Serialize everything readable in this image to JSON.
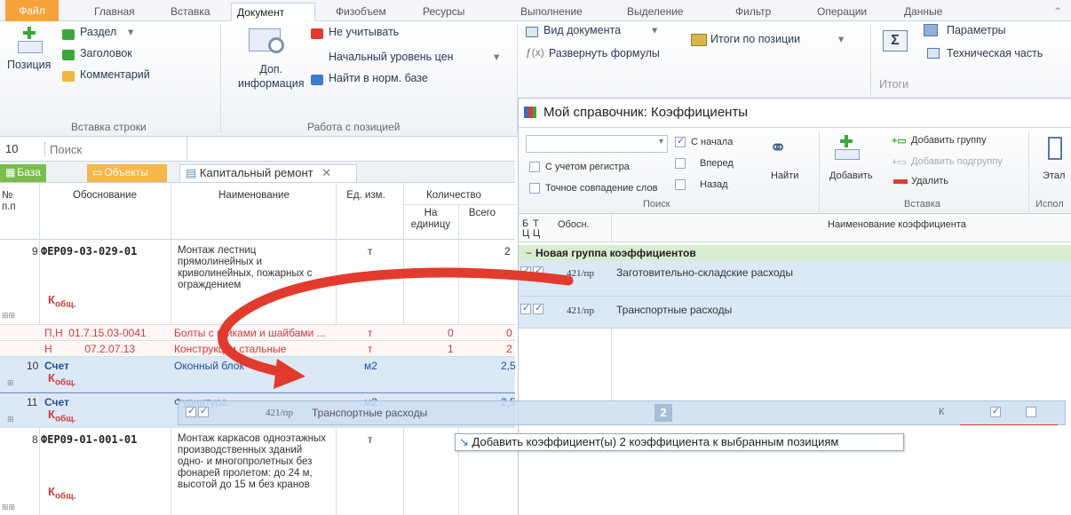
{
  "ribbon_tabs": [
    "Файл",
    "Главная",
    "Вставка",
    "Документ",
    "Физобъем",
    "Ресурсы",
    "Выполнение",
    "Выделение",
    "Фильтр",
    "Операции",
    "Данные"
  ],
  "ribbon": {
    "insert_row": {
      "position": "Позиция",
      "section": "Раздел",
      "header": "Заголовок",
      "comment": "Комментарий",
      "group_label": "Вставка строки"
    },
    "position_work": {
      "extra_info": "Доп.\nинформация",
      "ignore": "Не учитывать",
      "price_level": "Начальный уровень цен",
      "find_norm": "Найти в норм. базе",
      "group_label": "Работа с позицией"
    },
    "view": {
      "doc_view": "Вид документа",
      "expand_formulas": "Развернуть формулы",
      "totals_by_pos": "Итоги по позиции",
      "totals": "Итоги"
    },
    "params": {
      "parameters": "Параметры",
      "technical": "Техническая часть"
    }
  },
  "row2": {
    "number": "10",
    "search_placeholder": "Поиск"
  },
  "doc_tabs": {
    "base": "База",
    "objects": "Объекты",
    "current": "Капитальный ремонт"
  },
  "grid": {
    "headers": {
      "num": "№\nп.п",
      "basis": "Обоснование",
      "name": "Наименование",
      "unit": "Ед. изм.",
      "qty": "Количество",
      "per_unit": "На\nединицу",
      "total": "Всего"
    },
    "rows": [
      {
        "num": "9",
        "basis": "ФЕР09-03-029-01",
        "name": "Монтаж лестниц прямолинейных и криволинейных, пожарных с ограждением",
        "unit": "т",
        "total": "2",
        "k": "К",
        "k_sub": "общ."
      },
      {
        "num": "",
        "basis": "П,Н  01.7.15.03-0041",
        "name": "Болты с гайками и шайбами ...",
        "unit": "т",
        "per_unit": "0",
        "total": "0"
      },
      {
        "num": "",
        "basis": "Н           07.2.07.13",
        "name": "Конструкции стальные",
        "unit": "т",
        "per_unit": "1",
        "total": "2"
      },
      {
        "num": "10",
        "basis": "Счет",
        "name": "Оконный блок",
        "unit": "м2",
        "total": "2,5",
        "k": "К",
        "k_sub": "общ."
      },
      {
        "num": "11",
        "basis": "Счет",
        "name": "Фурнитура",
        "unit": "м2",
        "total": "2,5",
        "k": "К",
        "k_sub": "общ."
      },
      {
        "num": "8",
        "basis": "ФЕР09-01-001-01",
        "name": "Монтаж каркасов одноэтажных производственных зданий одно- и многопролетных без фонарей пролетом: до 24 м, высотой до 15 м без кранов",
        "unit": "т",
        "k": "К",
        "k_sub": "общ."
      }
    ]
  },
  "dialog": {
    "title": "Мой справочник: Коэффициенты",
    "search": {
      "from_start": "С начала",
      "forward": "Вперед",
      "back": "Назад",
      "case": "С учетом регистра",
      "exact": "Точное совпадение слов",
      "find": "Найти",
      "group_label": "Поиск"
    },
    "insert": {
      "add": "Добавить",
      "add_group": "Добавить группу",
      "add_subgroup": "Добавить подгруппу",
      "delete": "Удалить",
      "group_label": "Вставка"
    },
    "use": {
      "etalon": "Этал",
      "group_label": "Испол"
    },
    "table_headers": {
      "b": "Б\nЦ",
      "t": "Т\nЦ",
      "basis": "Обосн.",
      "name": "Наименование коэффициента"
    },
    "group": "Новая группа коэффициентов",
    "rows": [
      {
        "basis": "421/пр",
        "name": "Заготовительно-складские расходы"
      },
      {
        "basis": "421/пр",
        "name": "Транспортные расходы"
      }
    ]
  },
  "drag": {
    "basis": "421/пр",
    "name": "Транспортные расходы",
    "count": "2",
    "k": "К"
  },
  "tooltip": "Добавить коэффициент(ы) 2 коэффициента к выбранным позициям",
  "colors": {
    "file_tab": "#f5a23a",
    "arrow": "#e23b2e",
    "group_bg": "#d8ecd0",
    "row_bg": "#dbe9f6"
  }
}
